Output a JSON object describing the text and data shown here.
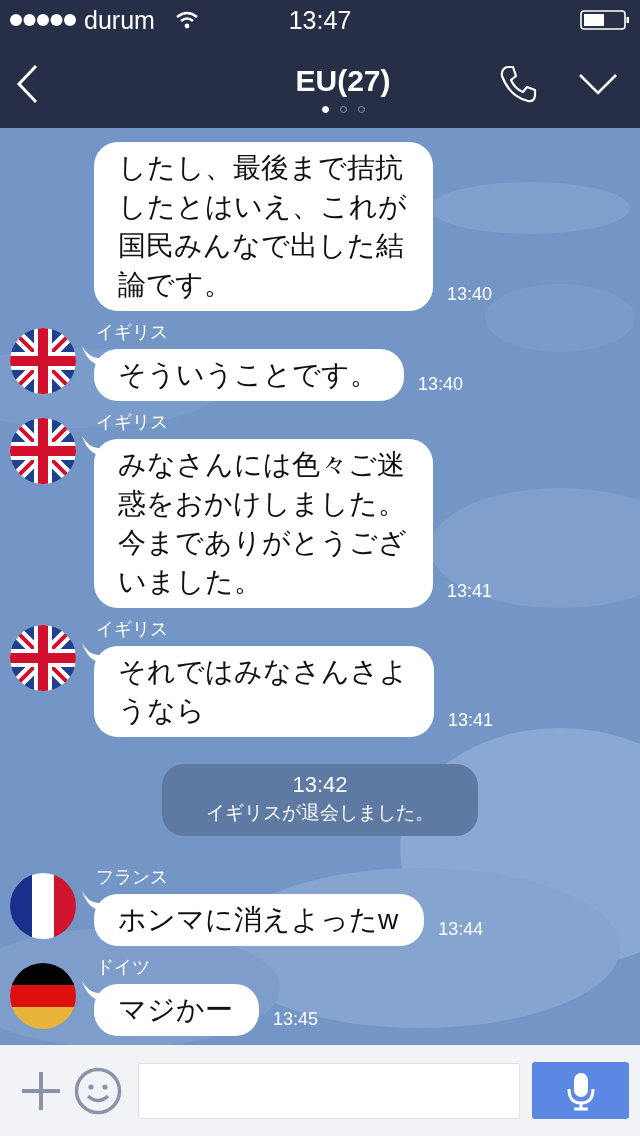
{
  "status_bar": {
    "carrier": "durum",
    "time": "13:47"
  },
  "header": {
    "title": "EU(27)",
    "page_dots": [
      {
        "selected": true
      },
      {
        "selected": false
      },
      {
        "selected": false
      }
    ]
  },
  "messages": [
    {
      "kind": "plain",
      "lines": [
        "したし、最後まで拮抗",
        "したとはいえ、これが",
        "国民みんなで出した結",
        "論です。"
      ],
      "time": "13:40"
    },
    {
      "kind": "unionjack",
      "sender": "イギリス",
      "lines": [
        "そういうことです。"
      ],
      "time": "13:40"
    },
    {
      "kind": "unionjack",
      "sender": "イギリス",
      "lines": [
        "みなさんには色々ご迷",
        "惑をおかけしました。",
        "今までありがとうござ",
        "いました。"
      ],
      "time": "13:41"
    },
    {
      "kind": "unionjack",
      "sender": "イギリス",
      "lines": [
        "それではみなさんさよ",
        "うなら"
      ],
      "time": "13:41"
    },
    {
      "kind": "system",
      "time": "13:42",
      "text": "イギリスが退会しました。"
    },
    {
      "kind": "vertical",
      "sender": "フランス",
      "lines": [
        "ホンマに消えよったw"
      ],
      "time": "13:44"
    },
    {
      "kind": "horizontal",
      "sender": "ドイツ",
      "lines": [
        "マジかー"
      ],
      "time": "13:45"
    }
  ]
}
